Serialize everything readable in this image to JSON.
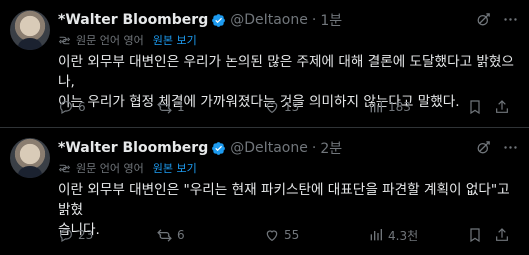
{
  "tweets": [
    {
      "name": "*Walter Bloomberg",
      "handle": "@DeItaone",
      "dot": "·",
      "time": "1분",
      "translate": {
        "original_language": "원문 언어 영어",
        "show_original": "원본 보기"
      },
      "text": "이란 외무부 대변인은 우리가 논의된 많은 주제에 대해 결론에 도달했다고 밝혔으나,\n이는 우리가 협정 체결에 가까워졌다는 것을 의미하지 않는다고 말했다.",
      "stats": {
        "replies": "6",
        "retweets": "1",
        "likes": "15",
        "views": "183"
      }
    },
    {
      "name": "*Walter Bloomberg",
      "handle": "@DeItaone",
      "dot": "·",
      "time": "2분",
      "translate": {
        "original_language": "원문 언어 영어",
        "show_original": "원본 보기"
      },
      "text": "이란 외무부 대변인은 \"우리는 현재 파키스탄에 대표단을 파견할 계획이 없다\"고 밝혔\n습니다.",
      "stats": {
        "replies": "23",
        "retweets": "6",
        "likes": "55",
        "views": "4.3천"
      }
    }
  ],
  "colors": {
    "background": "#000000",
    "text": "#e7e9ea",
    "muted": "#71767b",
    "link": "#1d9bf0",
    "divider": "#2f3336",
    "verified": "#1d9bf0"
  }
}
